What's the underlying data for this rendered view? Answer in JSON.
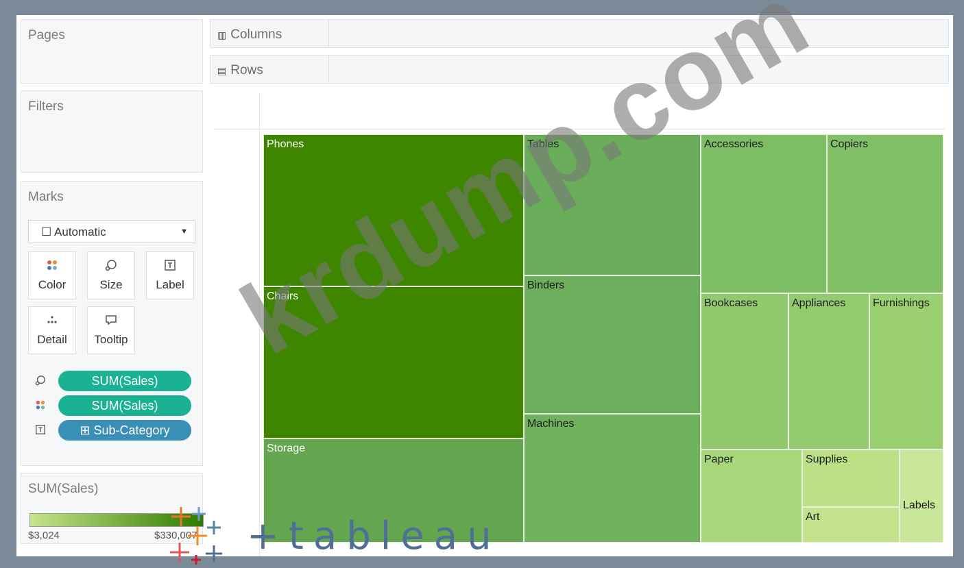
{
  "sidebar": {
    "pages_title": "Pages",
    "filters_title": "Filters",
    "marks": {
      "title": "Marks",
      "mark_type": "Automatic",
      "buttons": [
        {
          "label": "Color",
          "icon": "color-dots-icon"
        },
        {
          "label": "Size",
          "icon": "size-icon"
        },
        {
          "label": "Label",
          "icon": "label-icon"
        },
        {
          "label": "Detail",
          "icon": "detail-icon"
        },
        {
          "label": "Tooltip",
          "icon": "tooltip-icon"
        }
      ],
      "pills": [
        {
          "icon": "size-icon",
          "label": "SUM(Sales)",
          "color": "#1ab292"
        },
        {
          "icon": "color-dots-icon",
          "label": "SUM(Sales)",
          "color": "#1ab292"
        },
        {
          "icon": "label-icon",
          "label": "⊞ Sub-Category",
          "color": "#3a8fb7"
        }
      ]
    },
    "legend": {
      "title": "SUM(Sales)",
      "min": "$3,024",
      "max": "$330,007",
      "color_low": "#c6e48b",
      "color_high": "#2f7b00"
    }
  },
  "shelves": {
    "columns": "Columns",
    "rows": "Rows"
  },
  "treemap": {
    "cells": [
      {
        "label": "Phones",
        "color": "#3e8500"
      },
      {
        "label": "Chairs",
        "color": "#3f8600"
      },
      {
        "label": "Storage",
        "color": "#64a650"
      },
      {
        "label": "Tables",
        "color": "#6aad5a"
      },
      {
        "label": "Binders",
        "color": "#6cae5b"
      },
      {
        "label": "Machines",
        "color": "#70b25e"
      },
      {
        "label": "Accessories",
        "color": "#7cbd65"
      },
      {
        "label": "Copiers",
        "color": "#80bf66"
      },
      {
        "label": "Bookcases",
        "color": "#92c96e"
      },
      {
        "label": "Appliances",
        "color": "#93c96f"
      },
      {
        "label": "Furnishings",
        "color": "#9bd071"
      },
      {
        "label": "Paper",
        "color": "#a8d77b"
      },
      {
        "label": "Supplies",
        "color": "#bbe086"
      },
      {
        "label": "Art",
        "color": "#c2e28c"
      },
      {
        "label": "Labels",
        "color": "#c9e79a"
      }
    ]
  },
  "watermark": "krdump.com",
  "logo_text": "tableau"
}
